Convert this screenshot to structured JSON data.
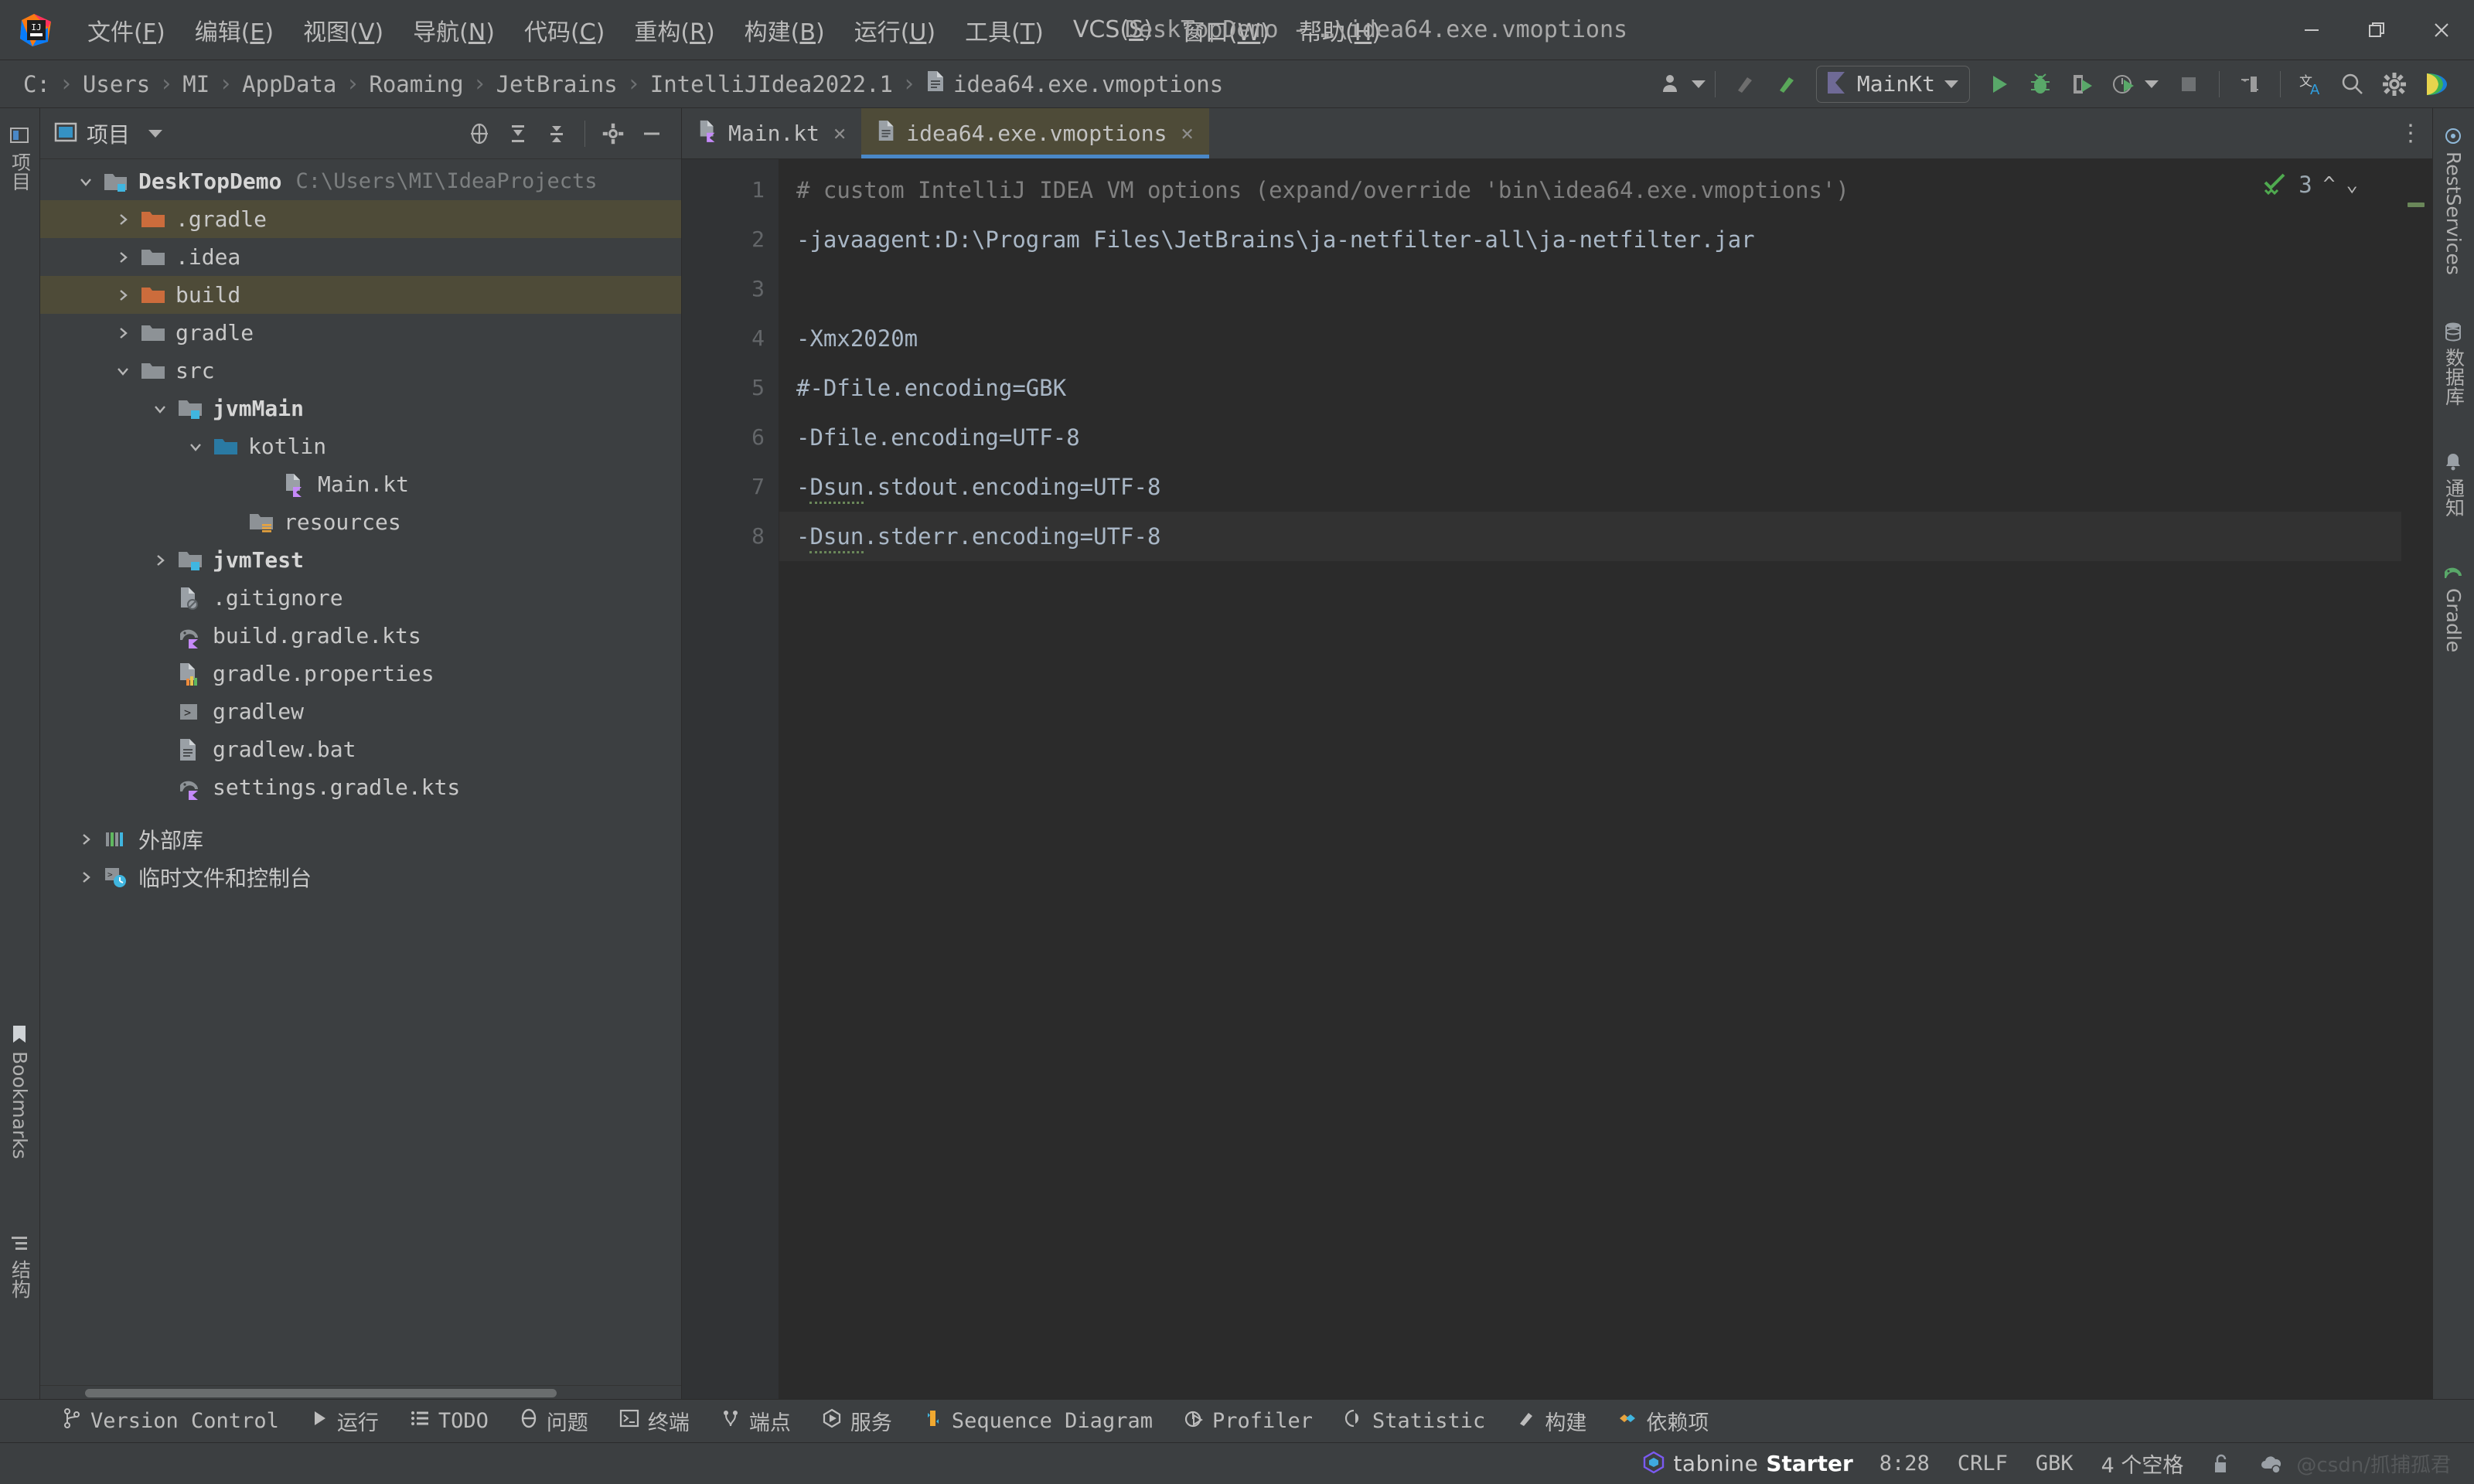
{
  "titlebar": {
    "logo_icon": "intellij-idea-logo",
    "menus": [
      {
        "label": "文件",
        "mnemonic": "F"
      },
      {
        "label": "编辑",
        "mnemonic": "E"
      },
      {
        "label": "视图",
        "mnemonic": "V"
      },
      {
        "label": "导航",
        "mnemonic": "N"
      },
      {
        "label": "代码",
        "mnemonic": "C"
      },
      {
        "label": "重构",
        "mnemonic": "R"
      },
      {
        "label": "构建",
        "mnemonic": "B"
      },
      {
        "label": "运行",
        "mnemonic": "U"
      },
      {
        "label": "工具",
        "mnemonic": "T"
      },
      {
        "label": "VCS",
        "mnemonic": "S"
      },
      {
        "label": "窗口",
        "mnemonic": "W"
      },
      {
        "label": "帮助",
        "mnemonic": "H"
      }
    ],
    "window_title": "DeskTopDemo - …\\idea64.exe.vmoptions",
    "minimize_icon": "minimize-icon",
    "maximize_icon": "restore-icon",
    "close_icon": "close-icon"
  },
  "navbar": {
    "breadcrumbs": [
      {
        "label": "C:",
        "icon": null
      },
      {
        "label": "Users",
        "icon": null
      },
      {
        "label": "MI",
        "icon": null
      },
      {
        "label": "AppData",
        "icon": null
      },
      {
        "label": "Roaming",
        "icon": null
      },
      {
        "label": "JetBrains",
        "icon": null
      },
      {
        "label": "IntelliJIdea2022.1",
        "icon": null
      },
      {
        "label": "idea64.exe.vmoptions",
        "icon": "file-icon"
      }
    ],
    "separator": "›",
    "run_config_label": "MainKt",
    "toolbar_icons": [
      "user-account-icon",
      "build-project-icon",
      "build-module-icon",
      "run-icon",
      "debug-icon",
      "run-with-coverage-icon",
      "profile-icon",
      "stop-icon",
      "updates-icon",
      "translate-icon",
      "search-everywhere-icon",
      "settings-gear-icon",
      "jetbrains-toolbox-icon"
    ]
  },
  "left_strip": {
    "tabs": [
      {
        "label": "项目",
        "icon": "project-tool-icon"
      },
      {
        "label": "Bookmarks",
        "icon": "bookmarks-icon"
      },
      {
        "label": "结构",
        "icon": "structure-icon"
      }
    ]
  },
  "project_panel": {
    "header_title": "项目",
    "header_icon": "project-window-icon",
    "header_dropdown_icon": "chevron-down-icon",
    "actions": [
      "select-opened-file-icon",
      "expand-all-icon",
      "collapse-all-icon",
      "settings-gear-icon",
      "hide-icon",
      "more-options-icon"
    ],
    "tree": [
      {
        "label": "DeskTopDemo",
        "path": "C:\\Users\\MI\\IdeaProjects",
        "depth": 0,
        "arrow": "down",
        "icon": "module-folder-icon",
        "bold": true,
        "highlight": false
      },
      {
        "label": ".gradle",
        "depth": 1,
        "arrow": "right",
        "icon": "folder-orange-icon",
        "bold": false,
        "highlight": true
      },
      {
        "label": ".idea",
        "depth": 1,
        "arrow": "right",
        "icon": "folder-icon",
        "bold": false,
        "highlight": false
      },
      {
        "label": "build",
        "depth": 1,
        "arrow": "right",
        "icon": "folder-orange-icon",
        "bold": false,
        "highlight": true
      },
      {
        "label": "gradle",
        "depth": 1,
        "arrow": "right",
        "icon": "folder-icon",
        "bold": false,
        "highlight": false
      },
      {
        "label": "src",
        "depth": 1,
        "arrow": "down",
        "icon": "folder-icon",
        "bold": false,
        "highlight": false
      },
      {
        "label": "jvmMain",
        "depth": 2,
        "arrow": "down",
        "icon": "source-root-folder-icon",
        "bold": true,
        "highlight": false
      },
      {
        "label": "kotlin",
        "depth": 3,
        "arrow": "down",
        "icon": "folder-blue-icon",
        "bold": false,
        "highlight": false
      },
      {
        "label": "Main.kt",
        "depth": 4,
        "arrow": "none",
        "icon": "kotlin-file-icon",
        "bold": false,
        "highlight": false
      },
      {
        "label": "resources",
        "depth": 3,
        "arrow": "none",
        "icon": "resources-folder-icon",
        "bold": false,
        "highlight": false
      },
      {
        "label": "jvmTest",
        "depth": 2,
        "arrow": "right",
        "icon": "test-root-folder-icon",
        "bold": true,
        "highlight": false
      },
      {
        "label": ".gitignore",
        "depth": 2,
        "arrow": "none",
        "icon": "gitignore-file-icon",
        "bold": false,
        "highlight": false
      },
      {
        "label": "build.gradle.kts",
        "depth": 2,
        "arrow": "none",
        "icon": "gradle-kts-file-icon",
        "bold": false,
        "highlight": false
      },
      {
        "label": "gradle.properties",
        "depth": 2,
        "arrow": "none",
        "icon": "properties-file-icon",
        "bold": false,
        "highlight": false
      },
      {
        "label": "gradlew",
        "depth": 2,
        "arrow": "none",
        "icon": "shell-script-icon",
        "bold": false,
        "highlight": false
      },
      {
        "label": "gradlew.bat",
        "depth": 2,
        "arrow": "none",
        "icon": "text-file-icon",
        "bold": false,
        "highlight": false
      },
      {
        "label": "settings.gradle.kts",
        "depth": 2,
        "arrow": "none",
        "icon": "gradle-kts-file-icon",
        "bold": false,
        "highlight": false
      },
      {
        "label": "外部库",
        "depth": 0,
        "arrow": "right",
        "icon": "external-libraries-icon",
        "bold": false,
        "highlight": false
      },
      {
        "label": "临时文件和控制台",
        "depth": 0,
        "arrow": "right",
        "icon": "scratches-icon",
        "bold": false,
        "highlight": false
      }
    ]
  },
  "editor": {
    "tabs": [
      {
        "label": "Main.kt",
        "icon": "kotlin-file-icon",
        "active": false,
        "close_icon": "close-icon"
      },
      {
        "label": "idea64.exe.vmoptions",
        "icon": "text-file-icon",
        "active": true,
        "close_icon": "close-icon"
      }
    ],
    "more_icon": "more-vertical-icon",
    "lines": [
      {
        "n": "1",
        "text": "# custom IntelliJ IDEA VM options (expand/override 'bin\\idea64.exe.vmoptions')",
        "kind": "comment"
      },
      {
        "n": "2",
        "text": "-javaagent:D:\\Program Files\\JetBrains\\ja-netfilter-all\\ja-netfilter.jar",
        "kind": "code"
      },
      {
        "n": "3",
        "text": "",
        "kind": "code"
      },
      {
        "n": "4",
        "text": "-Xmx2020m",
        "kind": "code"
      },
      {
        "n": "5",
        "text": "#-Dfile.encoding=GBK",
        "kind": "code"
      },
      {
        "n": "6",
        "text": "-Dfile.encoding=UTF-8",
        "kind": "code"
      },
      {
        "n": "7",
        "text": "-Dsun.stdout.encoding=UTF-8",
        "kind": "code",
        "squiggle": "Dsun"
      },
      {
        "n": "8",
        "text": "-Dsun.stderr.encoding=UTF-8",
        "kind": "code",
        "squiggle": "Dsun",
        "current": true
      }
    ],
    "inspection": {
      "icon": "inspection-ok-icon",
      "count": "3",
      "up_icon": "chevron-up-icon",
      "down_icon": "chevron-down-icon"
    }
  },
  "right_strip": {
    "tabs": [
      {
        "label": "RestServices",
        "icon": "rest-services-icon"
      },
      {
        "label": "数据库",
        "icon": "database-icon"
      },
      {
        "label": "通知",
        "icon": "notifications-icon"
      },
      {
        "label": "Gradle",
        "icon": "gradle-icon"
      }
    ]
  },
  "tool_windows": [
    {
      "label": "Version Control",
      "icon": "branch-icon",
      "cn": false
    },
    {
      "label": "运行",
      "icon": "run-icon",
      "cn": true
    },
    {
      "label": "TODO",
      "icon": "todo-list-icon",
      "cn": false
    },
    {
      "label": "问题",
      "icon": "problems-icon",
      "cn": true
    },
    {
      "label": "终端",
      "icon": "terminal-icon",
      "cn": true
    },
    {
      "label": "端点",
      "icon": "endpoints-icon",
      "cn": true
    },
    {
      "label": "服务",
      "icon": "services-icon",
      "cn": true
    },
    {
      "label": "Sequence Diagram",
      "icon": "sequence-diagram-icon",
      "cn": false
    },
    {
      "label": "Profiler",
      "icon": "profiler-icon",
      "cn": false
    },
    {
      "label": "Statistic",
      "icon": "statistic-icon",
      "cn": false
    },
    {
      "label": "构建",
      "icon": "build-icon",
      "cn": true
    },
    {
      "label": "依赖项",
      "icon": "dependencies-icon",
      "cn": true
    }
  ],
  "statusbar": {
    "tabnine_name": "tabnine",
    "tabnine_plan": "Starter",
    "tabnine_icon": "tabnine-logo-icon",
    "caret_position": "8:28",
    "line_separator": "CRLF",
    "encoding": "GBK",
    "indent": "4 个空格",
    "lock_icon": "unlocked-icon",
    "cloud_icon": "cloud-settings-icon",
    "watermark": "@csdn/抓捕孤君"
  },
  "colors": {
    "background": "#3c3f41",
    "editor_background": "#2b2b2b",
    "accent_blue": "#4a88c7",
    "highlight_olive": "#4e4b38",
    "text_primary": "#c8c8c8",
    "comment_gray": "#808080",
    "code_blue": "#a9b7c6",
    "green": "#59a869",
    "folder_orange": "#cc6c3c"
  }
}
